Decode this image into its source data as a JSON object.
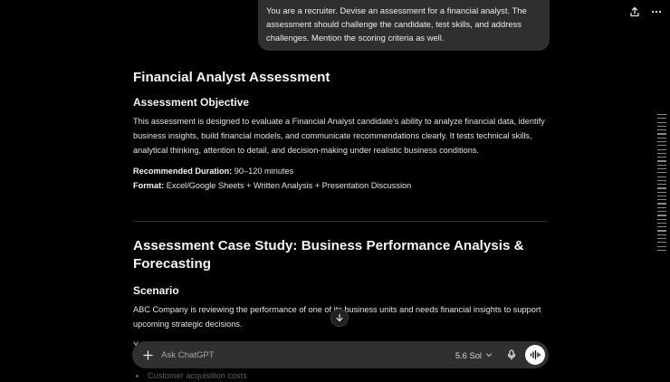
{
  "user_message": "You are a recruiter. Devise an assessment for a financial analyst. The assessment should challenge the candidate, test skills, and address challenges. Mention the scoring criteria as well.",
  "response": {
    "title": "Financial Analyst Assessment",
    "objective_heading": "Assessment Objective",
    "objective_text": "This assessment is designed to evaluate a Financial Analyst candidate's ability to analyze financial data, identify business insights, build financial models, and communicate recommendations clearly. It tests technical skills, analytical thinking, attention to detail, and decision-making under realistic business conditions.",
    "duration_label": "Recommended Duration:",
    "duration_value": " 90–120 minutes",
    "format_label": "Format:",
    "format_value": " Excel/Google Sheets + Written Analysis + Presentation Discussion",
    "case_title": "Assessment Case Study: Business Performance Analysis & Forecasting",
    "scenario_heading": "Scenario",
    "scenario_text": "ABC Company is reviewing the performance of one of its business units and needs financial insights to support upcoming strategic decisions.",
    "provided_text": "You are provided with:",
    "faded_item": "Customer acquisition costs"
  },
  "composer": {
    "placeholder": "Ask ChatGPT",
    "model_label": "5.6 Sol"
  },
  "icons": {
    "share": "share-icon",
    "more": "more-icon",
    "plus": "plus-icon",
    "chevron": "chevron-down-icon",
    "mic": "mic-icon",
    "voice": "voice-waveform-icon",
    "scroll_down": "arrow-down-icon"
  },
  "colors": {
    "background": "#000000",
    "bubble": "#2f2f2f",
    "composer": "#303030",
    "text": "#ececec"
  }
}
